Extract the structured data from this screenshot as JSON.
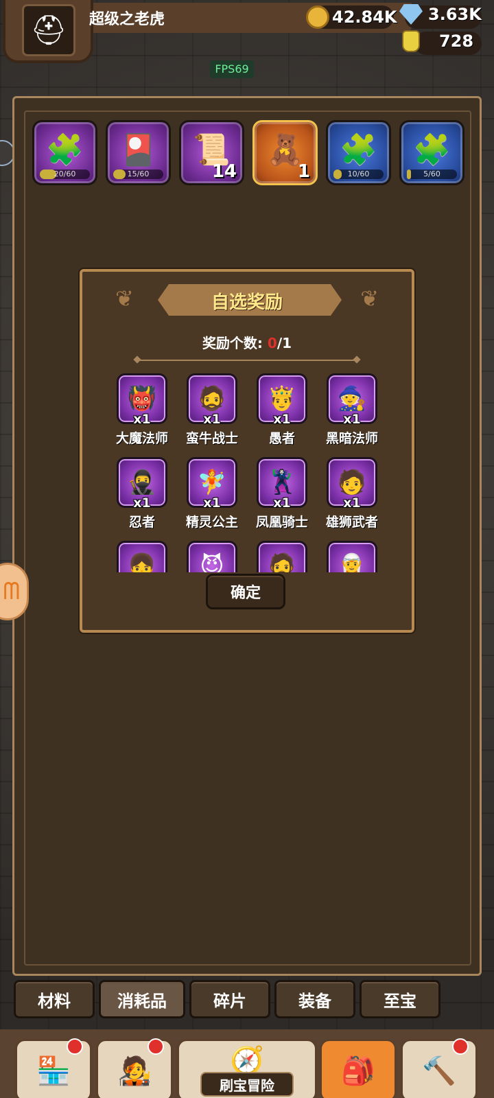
{
  "player": {
    "name": "超级之老虎",
    "avatar_icon": "knight-helmet-icon"
  },
  "resources": {
    "gold": "42.84K",
    "diamonds": "3.63K",
    "potion": "728"
  },
  "fps": "FPS69",
  "items": [
    {
      "icon": "gold-puzzle-icon",
      "glyph": "🧩",
      "rarity": "purple",
      "progress_label": "20/60",
      "progress": 0.333
    },
    {
      "icon": "blue-card-icon",
      "glyph": "🎴",
      "rarity": "purple",
      "progress_label": "15/60",
      "progress": 0.25
    },
    {
      "icon": "map-scroll-icon",
      "glyph": "📜",
      "rarity": "purple",
      "count": "14"
    },
    {
      "icon": "voodoo-doll-icon",
      "glyph": "🧸",
      "rarity": "orange",
      "count": "1"
    },
    {
      "icon": "purple-puzzle-icon",
      "glyph": "🧩",
      "rarity": "blue",
      "progress_label": "10/60",
      "progress": 0.167
    },
    {
      "icon": "teal-puzzle-icon",
      "glyph": "🧩",
      "rarity": "blue",
      "progress_label": "5/60",
      "progress": 0.083
    }
  ],
  "dialog": {
    "title": "自选奖励",
    "reward_label": "奖励个数:",
    "reward_current": "0",
    "reward_total": "/1",
    "confirm": "确定",
    "heroes": [
      {
        "name": "大魔法师",
        "qty": "x1",
        "glyph": "👹"
      },
      {
        "name": "蛮牛战士",
        "qty": "x1",
        "glyph": "🧔"
      },
      {
        "name": "愚者",
        "qty": "x1",
        "glyph": "🤴"
      },
      {
        "name": "黑暗法师",
        "qty": "x1",
        "glyph": "🧙"
      },
      {
        "name": "忍者",
        "qty": "x1",
        "glyph": "🥷"
      },
      {
        "name": "精灵公主",
        "qty": "x1",
        "glyph": "🧚"
      },
      {
        "name": "凤凰骑士",
        "qty": "x1",
        "glyph": "🦹"
      },
      {
        "name": "雄狮武者",
        "qty": "x1",
        "glyph": "🧑"
      },
      {
        "name": "",
        "qty": "",
        "glyph": "👧"
      },
      {
        "name": "",
        "qty": "",
        "glyph": "😈"
      },
      {
        "name": "",
        "qty": "",
        "glyph": "🧔"
      },
      {
        "name": "",
        "qty": "",
        "glyph": "🧝"
      }
    ]
  },
  "tabs": [
    {
      "label": "材料",
      "active": false
    },
    {
      "label": "消耗品",
      "active": true
    },
    {
      "label": "碎片",
      "active": false
    },
    {
      "label": "装备",
      "active": false
    },
    {
      "label": "至宝",
      "active": false
    }
  ],
  "bottom_nav": {
    "shop_icon": "shop-icon",
    "hero_icon": "hero-avatar-icon",
    "adventure_label": "刷宝冒险",
    "bag_icon": "backpack-icon",
    "forge_icon": "hammer-icon"
  }
}
